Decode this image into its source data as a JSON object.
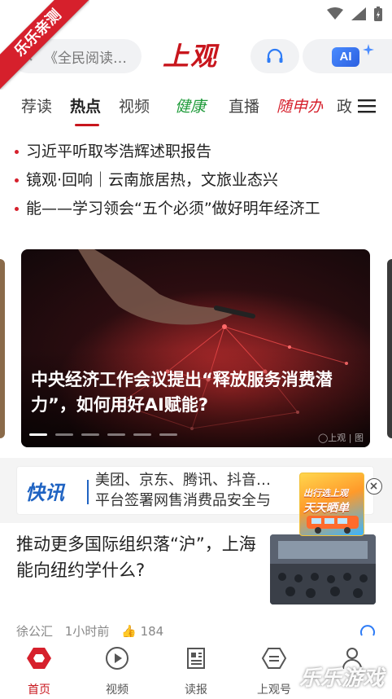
{
  "watermark_ribbon": "乐乐亲测",
  "header": {
    "search_placeholder": "《全民阅读…",
    "logo": "上观",
    "ai_label": "AI"
  },
  "tabs": [
    {
      "label": "荐读"
    },
    {
      "label": "热点",
      "active": true
    },
    {
      "label": "视频"
    },
    {
      "label": "健康"
    },
    {
      "label": "直播"
    },
    {
      "label": "随申办"
    },
    {
      "label": "政"
    }
  ],
  "ticker": [
    "习近平听取岑浩辉述职报告",
    "镜观·回响｜云南旅居热，文旅业态兴",
    "能——学习领会“五个必须”做好明年经济工"
  ],
  "carousel": {
    "title": "中央经济工作会议提出“释放服务消费潜力”，如何用好AI赋能?",
    "watermark": "◯上观 | 图",
    "slide_count": 6,
    "active_slide": 1
  },
  "flash": {
    "logo": "快讯",
    "lines": [
      "美团、京东、腾讯、抖音…",
      "平台签署网售消费品安全与"
    ]
  },
  "ad": {
    "lines": [
      "出行选上观",
      "天天晒单"
    ]
  },
  "article": {
    "title": "推动更多国际组织落“沪”，上海能向纽约学什么?",
    "source": "徐公汇",
    "time": "1小时前",
    "likes": "184"
  },
  "bottom_nav": [
    {
      "label": "首页",
      "icon": "home-hexagon-icon",
      "active": true
    },
    {
      "label": "视频",
      "icon": "play-circle-icon"
    },
    {
      "label": "读报",
      "icon": "newspaper-icon"
    },
    {
      "label": "上观号",
      "icon": "subscription-icon"
    },
    {
      "label": "",
      "icon": "user-icon"
    }
  ],
  "site_watermark": "乐乐游戏",
  "colors": {
    "brand": "#c8161d",
    "health": "#1f9b3a",
    "flash": "#1f63c2"
  }
}
